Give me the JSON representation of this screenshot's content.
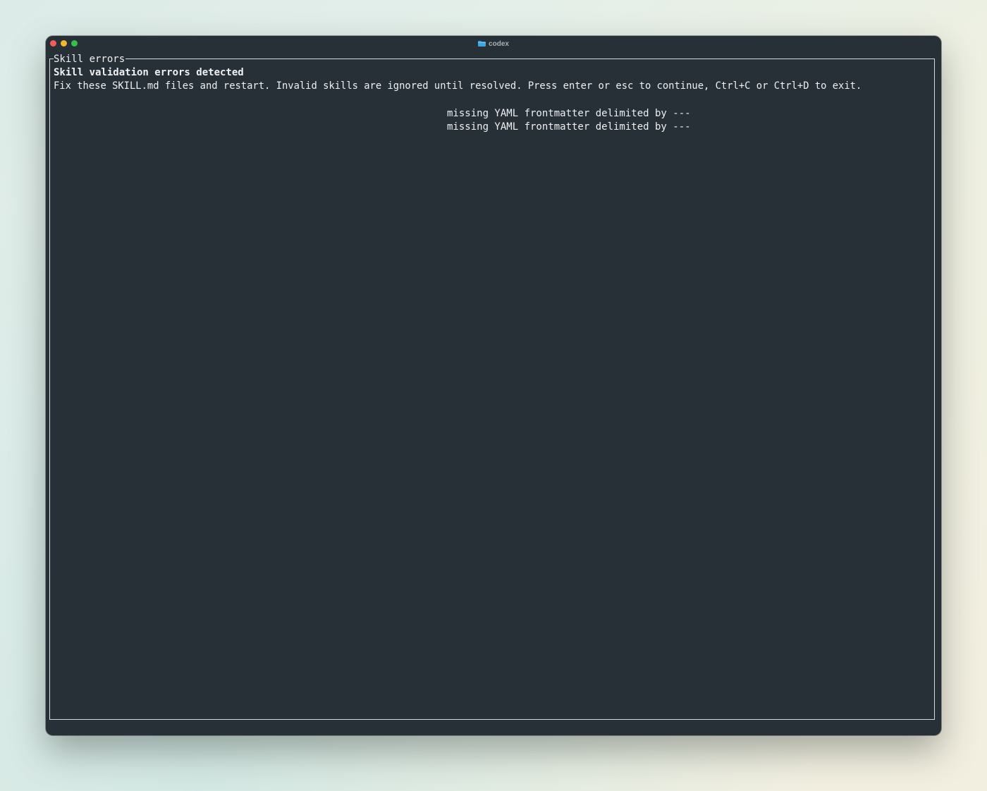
{
  "window": {
    "title": "codex",
    "title_icon": "folder-icon",
    "traffic_lights": [
      "close",
      "minimize",
      "zoom"
    ]
  },
  "dialog": {
    "title": "Skill errors",
    "heading": "Skill validation errors detected",
    "instructions": "Fix these SKILL.md files and restart. Invalid skills are ignored until resolved. Press enter or esc to continue, Ctrl+C or Ctrl+D to exit.",
    "errors": [
      "missing YAML frontmatter delimited by ---",
      "missing YAML frontmatter delimited by ---"
    ]
  },
  "colors": {
    "terminal_background": "#283037",
    "text": "#eef0f2",
    "border": "#d8dcdf",
    "close": "#f35e56",
    "minimize": "#f4b52f",
    "zoom": "#35c048",
    "folder_icon": "#3aa7e4"
  }
}
